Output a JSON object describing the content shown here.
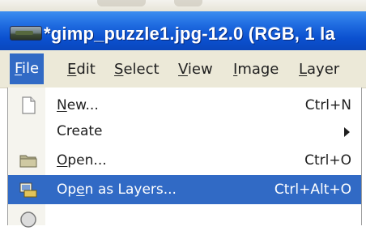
{
  "window": {
    "title": "*gimp_puzzle1.jpg-12.0 (RGB, 1 la"
  },
  "menubar": {
    "items": [
      {
        "label": "File",
        "mnemonic": "F",
        "rest": "ile",
        "active": true
      },
      {
        "label": "Edit",
        "mnemonic": "E",
        "rest": "dit"
      },
      {
        "label": "Select",
        "mnemonic": "S",
        "rest": "elect"
      },
      {
        "label": "View",
        "mnemonic": "V",
        "rest": "iew"
      },
      {
        "label": "Image",
        "mnemonic": "I",
        "rest": "mage"
      },
      {
        "label": "Layer",
        "mnemonic": "L",
        "rest": "ayer"
      }
    ]
  },
  "file_menu": {
    "items": [
      {
        "label": "New...",
        "mnemonic": "N",
        "rest": "ew...",
        "shortcut": "Ctrl+N",
        "icon": "new-document-icon"
      },
      {
        "label": "Create",
        "shortcut": "",
        "submenu": true
      },
      {
        "label": "Open...",
        "mnemonic": "O",
        "rest": "pen...",
        "shortcut": "Ctrl+O",
        "icon": "folder-icon"
      },
      {
        "label": "Open as Layers...",
        "before": "Op",
        "mnemonic": "e",
        "rest": "n as Layers...",
        "shortcut": "Ctrl+Alt+O",
        "icon": "open-as-layers-icon",
        "highlighted": true
      }
    ]
  },
  "colors": {
    "titlebar": "#0b50cf",
    "menubar_bg": "#ece9d8",
    "highlight": "#316ac5"
  }
}
